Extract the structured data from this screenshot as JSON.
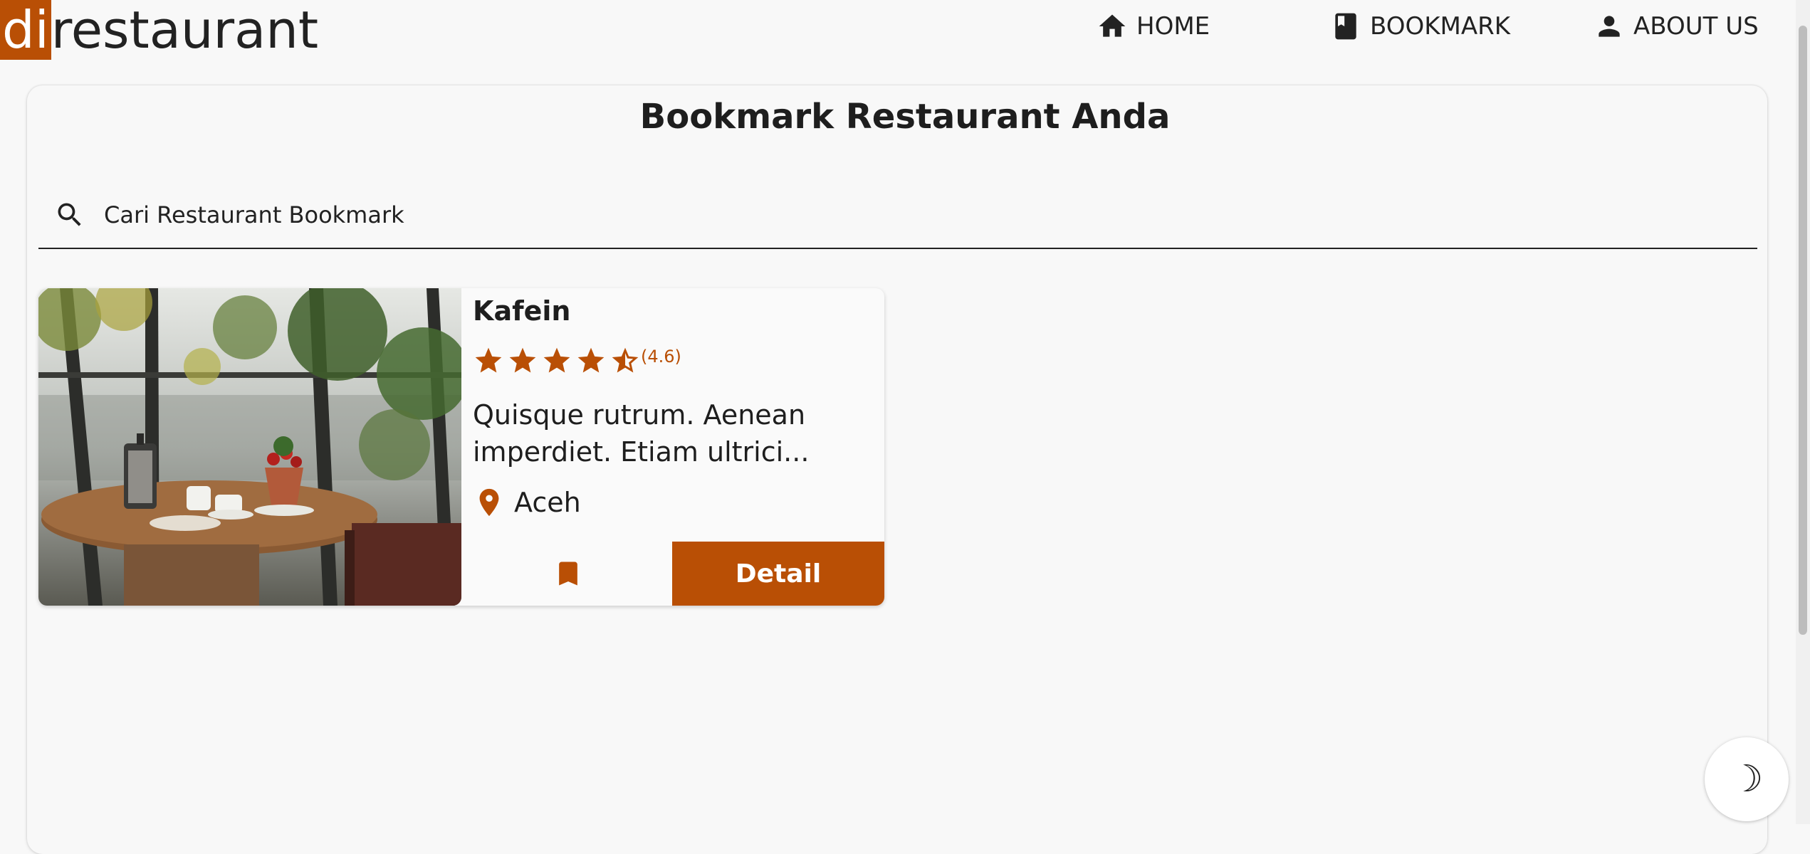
{
  "brand": {
    "highlight": "di",
    "rest": "restaurant",
    "accent_color": "#b94f05"
  },
  "nav": {
    "home": {
      "label": "HOME",
      "icon": "home-icon"
    },
    "bookmark": {
      "label": "BOOKMARK",
      "icon": "book-icon"
    },
    "about": {
      "label": "ABOUT US",
      "icon": "person-icon"
    }
  },
  "main": {
    "title": "Bookmark Restaurant Anda",
    "search": {
      "placeholder": "Cari Restaurant Bookmark",
      "value": "",
      "icon": "search-icon"
    }
  },
  "restaurants": [
    {
      "name": "Kafein",
      "rating": 4.6,
      "rating_text": "(4.6)",
      "stars": {
        "full": 4,
        "half": 1,
        "icon": "star-icon"
      },
      "description": "Quisque rutrum. Aenean imperdiet. Etiam ultrici...",
      "city": "Aceh",
      "bookmark_icon": "bookmark-icon",
      "detail_label": "Detail"
    }
  ],
  "theme_toggle": {
    "icon": "moon-icon",
    "glyph": "☽"
  }
}
